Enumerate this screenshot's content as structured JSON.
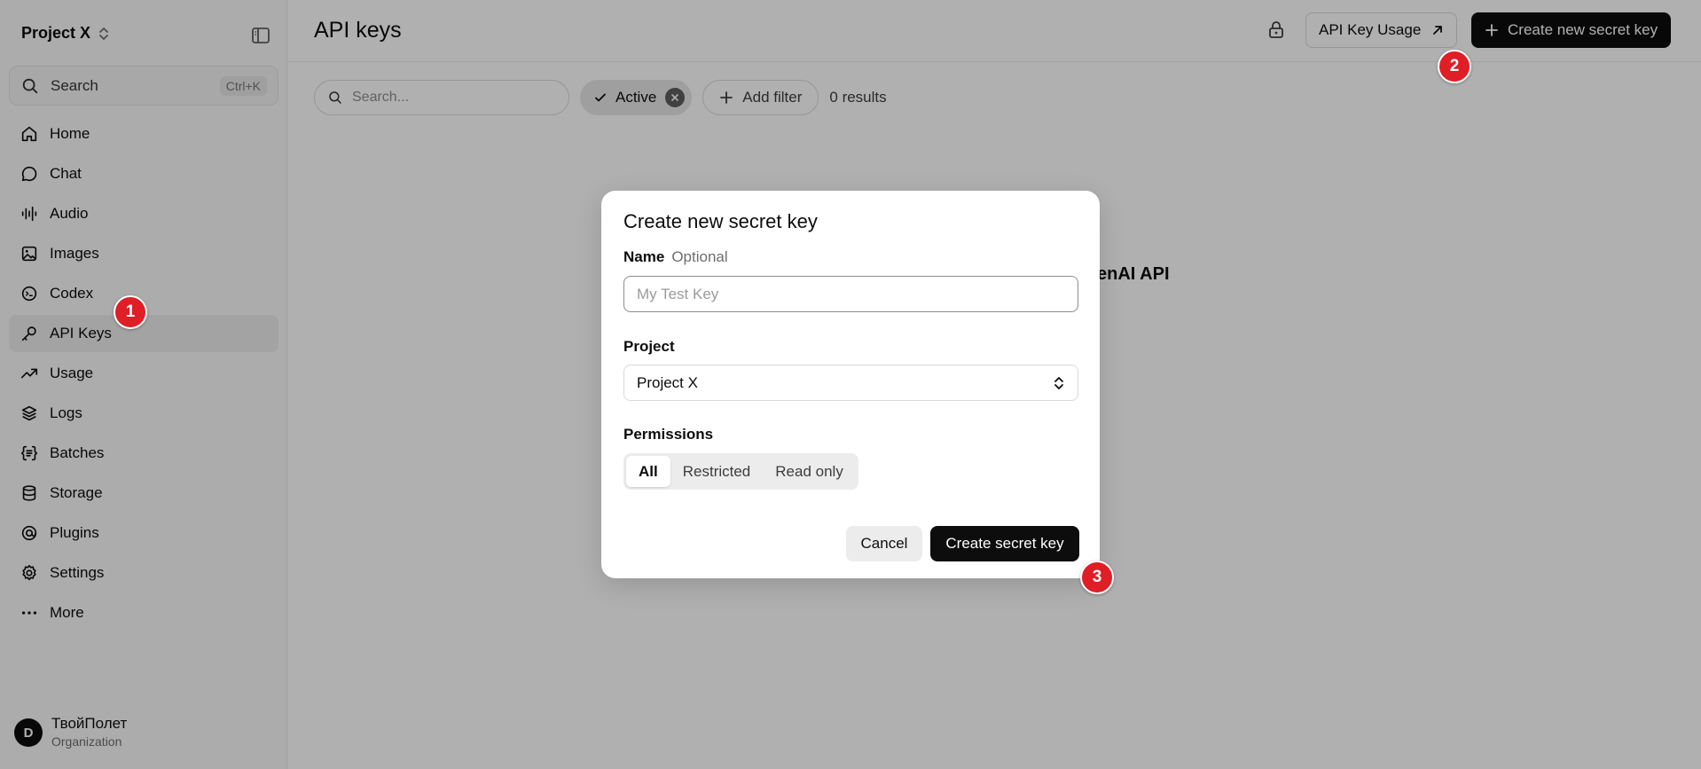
{
  "sidebar": {
    "project_name": "Project X",
    "search": {
      "label": "Search",
      "shortcut": "Ctrl+K"
    },
    "items": [
      {
        "label": "Home",
        "icon": "home-icon"
      },
      {
        "label": "Chat",
        "icon": "chat-icon"
      },
      {
        "label": "Audio",
        "icon": "audio-icon"
      },
      {
        "label": "Images",
        "icon": "image-icon"
      },
      {
        "label": "Codex",
        "icon": "codex-icon"
      },
      {
        "label": "API Keys",
        "icon": "key-icon",
        "active": true
      },
      {
        "label": "Usage",
        "icon": "trend-icon"
      },
      {
        "label": "Logs",
        "icon": "logs-icon"
      },
      {
        "label": "Batches",
        "icon": "batches-icon"
      },
      {
        "label": "Storage",
        "icon": "database-icon"
      },
      {
        "label": "Plugins",
        "icon": "plugin-icon"
      },
      {
        "label": "Settings",
        "icon": "gear-icon"
      },
      {
        "label": "More",
        "icon": "more-icon"
      }
    ],
    "org": {
      "avatar_letter": "D",
      "name": "ТвойПолет",
      "type": "Organization"
    }
  },
  "header": {
    "title": "API keys",
    "usage_button": "API Key Usage",
    "create_button": "Create new secret key"
  },
  "filters": {
    "search_placeholder": "Search...",
    "active_chip": "Active",
    "add_filter": "Add filter",
    "results": "0 results"
  },
  "background": {
    "empty_text_fragment": "enAI API"
  },
  "modal": {
    "title": "Create new secret key",
    "name_label": "Name",
    "name_optional": "Optional",
    "name_placeholder": "My Test Key",
    "project_label": "Project",
    "project_value": "Project X",
    "permissions_label": "Permissions",
    "permissions_options": [
      "All",
      "Restricted",
      "Read only"
    ],
    "permissions_selected": "All",
    "cancel": "Cancel",
    "submit": "Create secret key"
  },
  "markers": [
    "1",
    "2",
    "3"
  ],
  "colors": {
    "marker": "#e01e26",
    "primary_button": "#0d0d0d",
    "overlay": "rgba(0,0,0,0.31)"
  }
}
